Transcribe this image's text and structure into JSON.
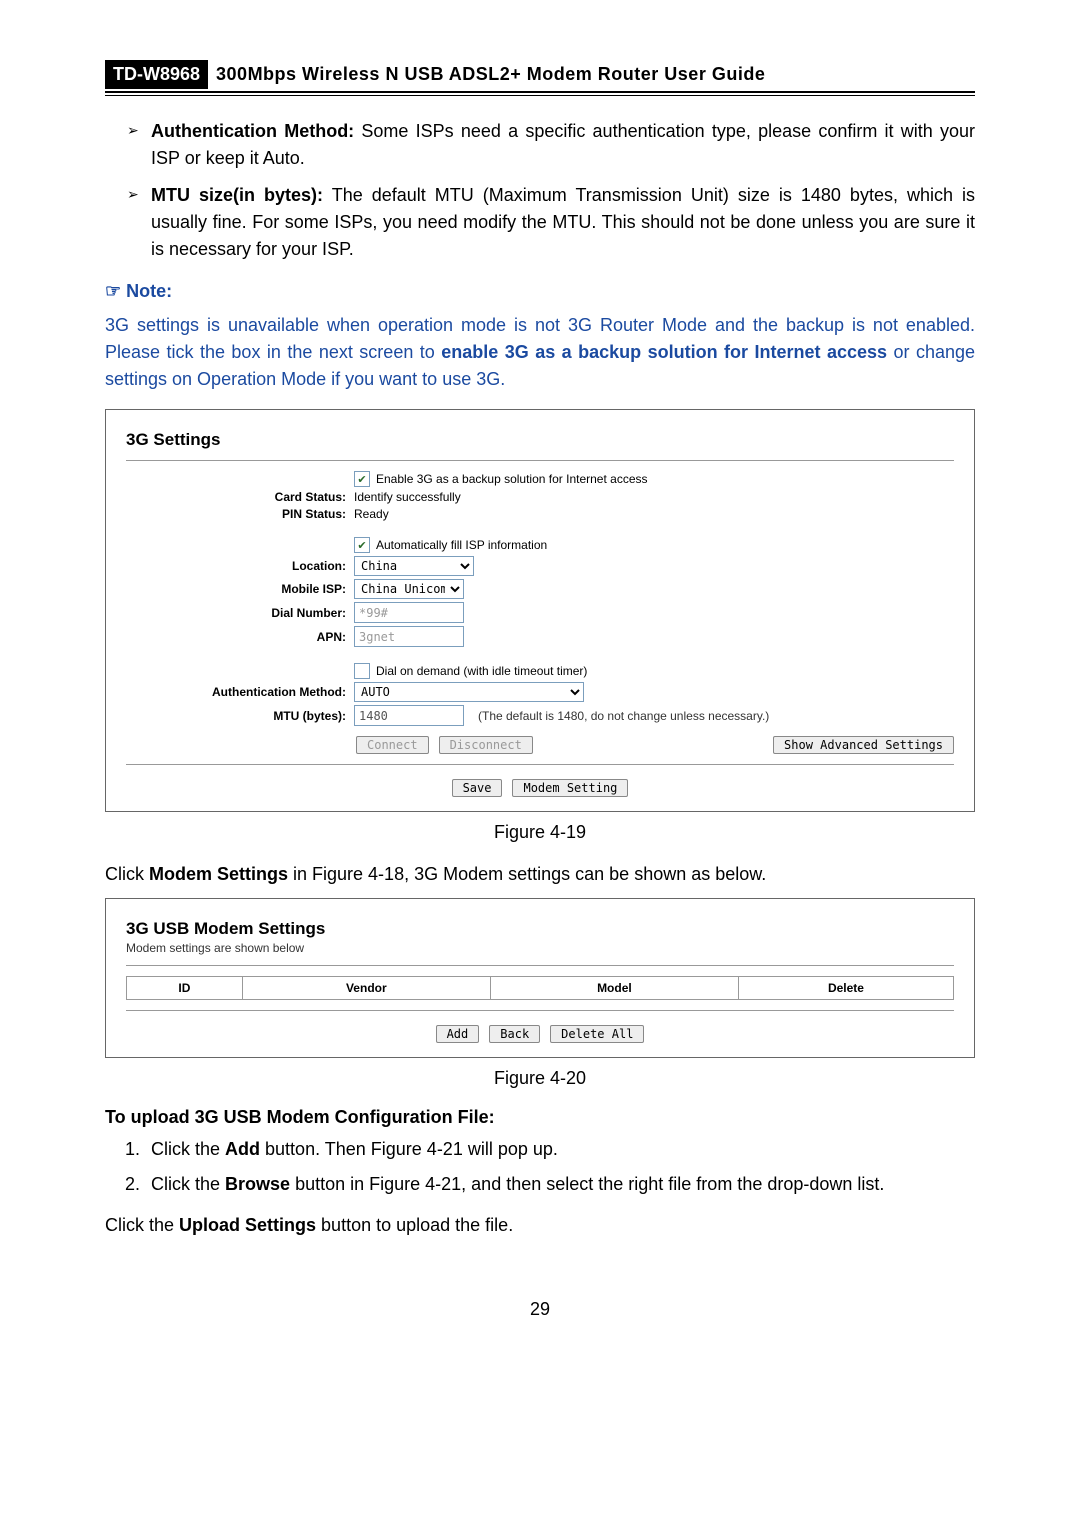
{
  "header": {
    "model": "TD-W8968",
    "title": "300Mbps Wireless N USB ADSL2+ Modem Router User Guide"
  },
  "bullets": [
    {
      "term": "Authentication Method:",
      "text": " Some ISPs need a specific authentication type, please confirm it with your ISP or keep it Auto."
    },
    {
      "term": "MTU size(in bytes):",
      "text": " The default MTU (Maximum Transmission Unit) size is 1480 bytes, which is usually fine. For some ISPs, you need modify the MTU. This should not be done unless you are sure it is necessary for your ISP."
    }
  ],
  "note": {
    "label": "Note:",
    "body_pre": "3G settings is unavailable when operation mode is not 3G Router Mode and the backup is not enabled. Please tick the box in the next screen to ",
    "body_bold": "enable 3G as a backup solution for Internet access",
    "body_post": " or change settings on Operation Mode if you want to use 3G."
  },
  "panel3g": {
    "title": "3G Settings",
    "enable_label": "Enable 3G as a backup solution for Internet access",
    "card_status_label": "Card Status:",
    "card_status_value": "Identify successfully",
    "pin_status_label": "PIN Status:",
    "pin_status_value": "Ready",
    "auto_fill_label": "Automatically fill ISP information",
    "location_label": "Location:",
    "location_value": "China",
    "mobile_isp_label": "Mobile ISP:",
    "mobile_isp_value": "China Unicom",
    "dial_label": "Dial Number:",
    "dial_value": "*99#",
    "apn_label": "APN:",
    "apn_value": "3gnet",
    "dod_label": "Dial on demand (with idle timeout timer)",
    "auth_label": "Authentication Method:",
    "auth_value": "AUTO",
    "mtu_label": "MTU (bytes):",
    "mtu_value": "1480",
    "mtu_hint": "(The default is 1480, do not change unless necessary.)",
    "btn_connect": "Connect",
    "btn_disconnect": "Disconnect",
    "btn_adv": "Show Advanced Settings",
    "btn_save": "Save",
    "btn_modem": "Modem Setting"
  },
  "fig419": "Figure 4-19",
  "click_modem_pre": "Click ",
  "click_modem_bold": "Modem Settings",
  "click_modem_post": " in Figure 4-18, 3G Modem settings can be shown as below.",
  "panelUsb": {
    "title": "3G USB Modem Settings",
    "sub": "Modem settings are shown below",
    "col_id": "ID",
    "col_vendor": "Vendor",
    "col_model": "Model",
    "col_delete": "Delete",
    "btn_add": "Add",
    "btn_back": "Back",
    "btn_delall": "Delete All"
  },
  "fig420": "Figure 4-20",
  "upload_head": "To upload 3G USB Modem Configuration File:",
  "steps": [
    {
      "pre": "Click the ",
      "bold": "Add",
      "post": " button. Then Figure 4-21 will pop up."
    },
    {
      "pre": "Click the ",
      "bold": "Browse",
      "post": " button in Figure 4-21, and then select the right file from the drop-down list."
    }
  ],
  "upload_tail_pre": "Click the ",
  "upload_tail_bold": "Upload Settings",
  "upload_tail_post": " button to upload the file.",
  "page_no": "29"
}
